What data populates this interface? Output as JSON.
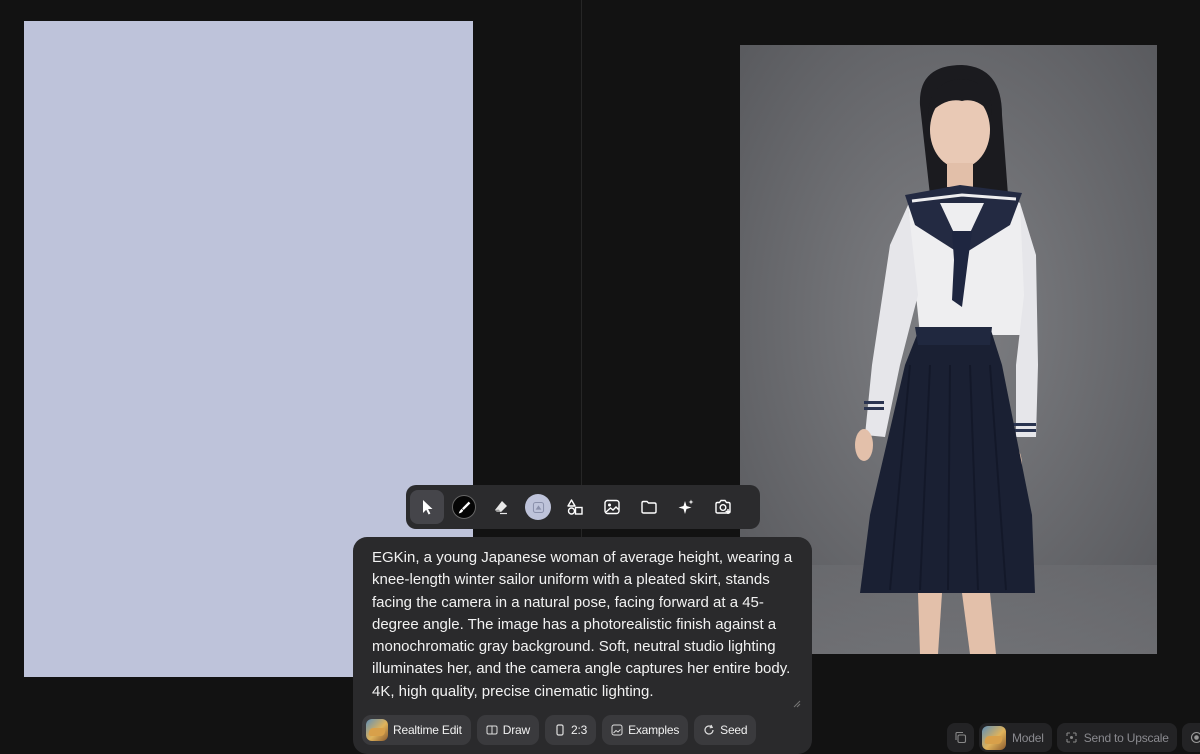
{
  "canvas": {
    "background_color": "#bec3da"
  },
  "result": {
    "description_alt": "Generated image"
  },
  "toolbar": {
    "tools": [
      {
        "name": "select",
        "icon": "cursor-arrow-icon",
        "active": true
      },
      {
        "name": "brush",
        "icon": "brush-icon",
        "active": false
      },
      {
        "name": "eraser",
        "icon": "eraser-icon",
        "active": false
      },
      {
        "name": "color",
        "icon": "color-swatch-icon",
        "active": false
      },
      {
        "name": "shapes",
        "icon": "shapes-icon",
        "active": false
      },
      {
        "name": "image",
        "icon": "image-icon",
        "active": false
      },
      {
        "name": "folder",
        "icon": "folder-icon",
        "active": false
      },
      {
        "name": "magic",
        "icon": "sparkles-icon",
        "active": false
      },
      {
        "name": "camera",
        "icon": "camera-add-icon",
        "active": false
      }
    ]
  },
  "prompt": {
    "text": "EGKin, a young Japanese woman of average height, wearing a knee-length winter sailor uniform with a pleated skirt, stands facing the camera in a natural pose, facing forward at a 45-degree angle. The image has a photorealistic finish against a monochromatic gray background. Soft, neutral studio lighting illuminates her, and the camera angle captures her entire body. 4K, high quality, precise cinematic lighting."
  },
  "chips": {
    "realtime_edit": "Realtime Edit",
    "draw": "Draw",
    "ratio": "2:3",
    "examples": "Examples",
    "seed": "Seed"
  },
  "bottom_right": {
    "model_label": "Model",
    "upscale_label": "Send to Upscale"
  }
}
